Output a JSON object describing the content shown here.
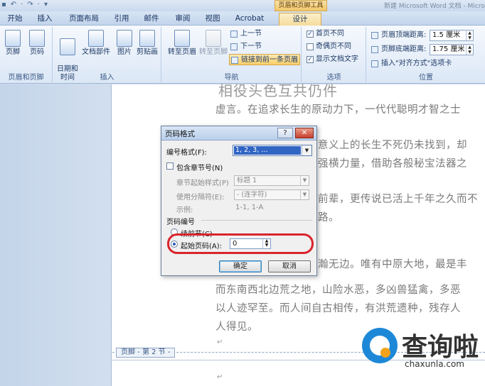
{
  "window": {
    "title": "新建 Microsoft Word 文档 - Micro",
    "context_tab_title": "页眉和页脚工具",
    "qat": [
      "▪",
      "↶",
      "·",
      "↷",
      "·",
      "▾"
    ]
  },
  "tabs": [
    {
      "label": "开始"
    },
    {
      "label": "插入"
    },
    {
      "label": "页面布局"
    },
    {
      "label": "引用"
    },
    {
      "label": "邮件"
    },
    {
      "label": "审阅"
    },
    {
      "label": "视图"
    },
    {
      "label": "Acrobat"
    },
    {
      "label": "设计"
    }
  ],
  "ribbon": {
    "group_header_footer": {
      "label": "页眉和页脚",
      "footer_btn": "页脚",
      "pagenum_btn": "页码"
    },
    "group_insert": {
      "label": "插入",
      "datetime_btn": "日期和\n时间",
      "docparts_btn": "文档部件",
      "picture_btn": "图片",
      "clipart_btn": "剪贴画"
    },
    "group_nav": {
      "label": "导航",
      "goto_header_btn": "转至页眉",
      "goto_footer_btn": "转至页脚",
      "prev_btn": "上一节",
      "next_btn": "下一节",
      "link_prev_btn": "链接到前一条页眉"
    },
    "group_options": {
      "label": "选项",
      "diff_first": "首页不同",
      "diff_odd_even": "奇偶页不同",
      "show_doc_text": "显示文档文字"
    },
    "group_position": {
      "label": "位置",
      "header_top_label": "页眉顶端距离:",
      "header_top_value": "1.5 厘米",
      "footer_bottom_label": "页脚底端距离:",
      "footer_bottom_value": "1.75 厘米",
      "insert_align_tab": "插入\"对齐方式\"选项卡"
    }
  },
  "document": {
    "title_fragment": "相役头色互共仍件",
    "lines": [
      "虚言。在追求长生的原动力下，一代代聪明才智之士",
      "意义上的长生不死仍未找到，却",
      "强横力量，借助各般秘宝法器之",
      "前辈，更传说已活上千年之久而不",
      "路。",
      "瀚无边。唯有中原大地，最是丰",
      "而东南西北边荒之地，山险水恶，多凶兽猛禽，多恶",
      "以人迹罕至。而人间自古相传，有洪荒遗种，残存人",
      "人得见。"
    ],
    "footer_label": "页脚 - 第 2 节 -",
    "para_mark": "↵"
  },
  "dialog": {
    "title": "页码格式",
    "help": "?",
    "close": "✕",
    "number_format_label": "编号格式(F):",
    "number_format_value": "1, 2, 3, …",
    "include_chapter_label": "包含章节号(N)",
    "chapter_style_label": "章节起始样式(P)",
    "chapter_style_value": "标题 1",
    "separator_label": "使用分隔符(E):",
    "separator_value": "-  (连字符)",
    "example_label": "示例:",
    "example_value": "1-1, 1-A",
    "page_numbering_label": "页码编号",
    "continue_label": "续前节(C)",
    "start_at_label": "起始页码(A):",
    "start_at_value": "0",
    "ok": "确定",
    "cancel": "取消"
  },
  "logo": {
    "text": "查询啦",
    "url": "chaxunla.com",
    "brand_blue": "#1e88d8",
    "accent_orange": "#f2a21a"
  },
  "colors": {
    "highlight_red": "#d9242d",
    "selection_blue": "#3165c4"
  }
}
